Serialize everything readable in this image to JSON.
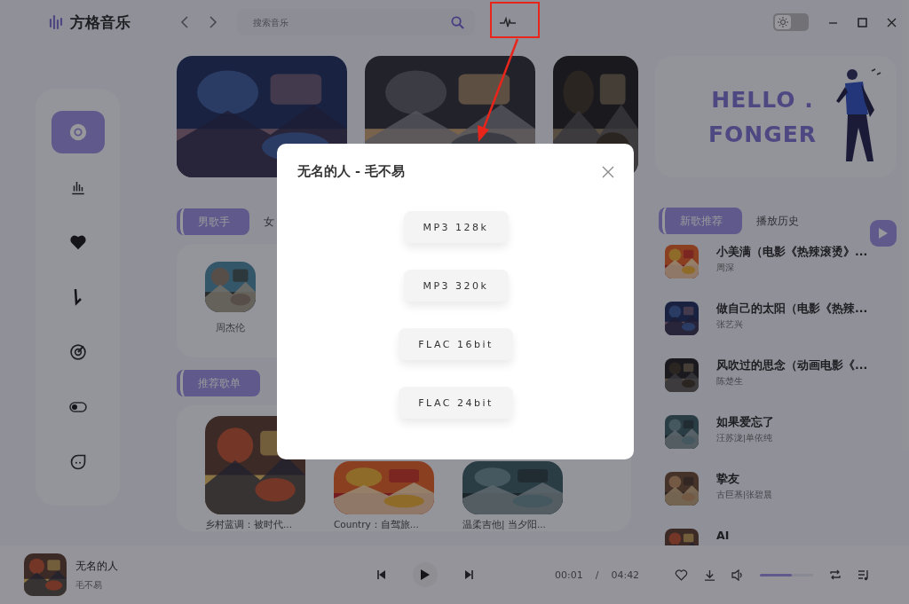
{
  "app": {
    "title": "方格音乐"
  },
  "search": {
    "placeholder": "搜索音乐"
  },
  "theme": {
    "dark": false
  },
  "sidebar": {
    "items": [
      {
        "kind": "disc",
        "selected": true
      },
      {
        "kind": "chart",
        "selected": false
      },
      {
        "kind": "heart",
        "selected": false
      },
      {
        "kind": "note",
        "selected": false
      },
      {
        "kind": "radar",
        "selected": false
      },
      {
        "kind": "toggle",
        "selected": false
      },
      {
        "kind": "chat",
        "selected": false
      }
    ]
  },
  "hello_card": {
    "lines": [
      "HELLO .",
      "FONGER"
    ]
  },
  "singer_tabs": [
    {
      "label": "男歌手",
      "selected": true
    },
    {
      "label": "女",
      "selected": false
    }
  ],
  "singers": [
    {
      "name": "周杰伦"
    }
  ],
  "playlist_tabs": [
    {
      "label": "推荐歌单",
      "selected": true
    }
  ],
  "playlists": [
    {
      "title": "乡村蓝调：被时代..."
    },
    {
      "title": "Country：自驾旅..."
    },
    {
      "title": "温柔吉他| 当夕阳..."
    }
  ],
  "song_tabs": [
    {
      "label": "新歌推荐",
      "selected": true
    },
    {
      "label": "播放历史",
      "selected": false
    }
  ],
  "songs": [
    {
      "title": "小美满（电影《热辣滚烫》...",
      "artist": "周深"
    },
    {
      "title": "做自己的太阳（电影《热辣...",
      "artist": "张艺兴"
    },
    {
      "title": "风吹过的思念（动画电影《...",
      "artist": "陈楚生"
    },
    {
      "title": "如果爱忘了",
      "artist": "汪苏泷|单依纯"
    },
    {
      "title": "挚友",
      "artist": "古巨基|张碧晨"
    },
    {
      "title": "AI"
    }
  ],
  "player": {
    "title": "无名的人",
    "artist": "毛不易",
    "elapsed": "00:01",
    "separator": "/",
    "total": "04:42",
    "volume": {
      "level": 0.6
    }
  },
  "dialog": {
    "title": "无名的人 - 毛不易",
    "options": [
      "MP3 128k",
      "MP3 320k",
      "FLAC 16bit",
      "FLAC 24bit"
    ]
  }
}
